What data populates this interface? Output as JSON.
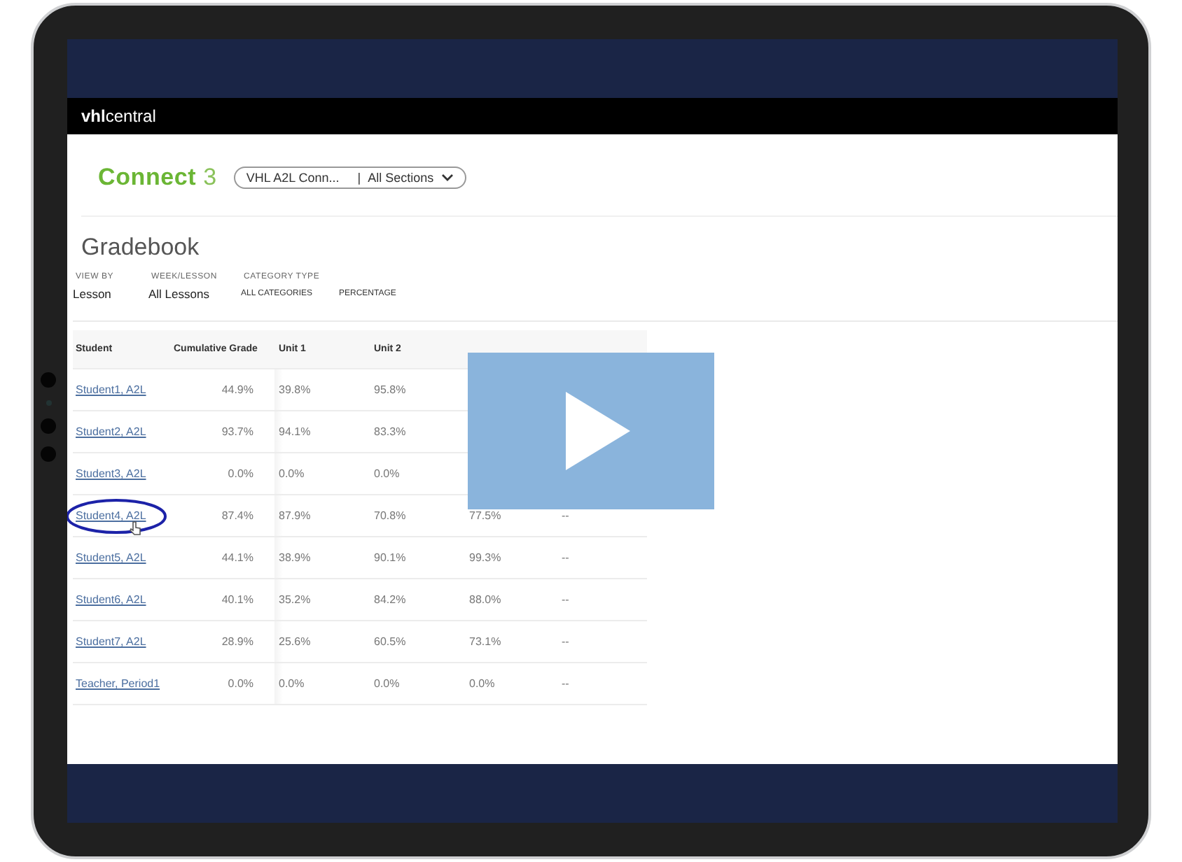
{
  "header": {
    "brand_bold": "vhl",
    "brand_light": "central"
  },
  "product": {
    "name": "Connect",
    "version": "3"
  },
  "course_select": {
    "course": "VHL A2L Conn...",
    "separator": "|",
    "section": "All Sections"
  },
  "page_title": "Gradebook",
  "filters": [
    {
      "label": "VIEW BY",
      "value": "Lesson",
      "kind": "large"
    },
    {
      "label": "WEEK/LESSON",
      "value": "All Lessons",
      "kind": "large"
    },
    {
      "label": "CATEGORY TYPE",
      "value": "ALL CATEGORIES",
      "kind": "small"
    },
    {
      "value": "PERCENTAGE",
      "kind": "small"
    }
  ],
  "table": {
    "columns": [
      "Student",
      "Cumulative Grade",
      "Unit 1",
      "Unit 2"
    ],
    "rows": [
      {
        "circled": false,
        "cells": [
          "Student1, A2L",
          "44.9%",
          "39.8%",
          "95.8%"
        ]
      },
      {
        "circled": false,
        "cells": [
          "Student2, A2L",
          "93.7%",
          "94.1%",
          "83.3%"
        ]
      },
      {
        "circled": false,
        "cells": [
          "Student3, A2L",
          "0.0%",
          "0.0%",
          "0.0%"
        ]
      },
      {
        "circled": true,
        "cells": [
          "Student4, A2L",
          "87.4%",
          "87.9%",
          "70.8%",
          "77.5%",
          "--"
        ]
      },
      {
        "circled": false,
        "cells": [
          "Student5, A2L",
          "44.1%",
          "38.9%",
          "90.1%",
          "99.3%",
          "--"
        ]
      },
      {
        "circled": false,
        "cells": [
          "Student6, A2L",
          "40.1%",
          "35.2%",
          "84.2%",
          "88.0%",
          "--"
        ]
      },
      {
        "circled": false,
        "cells": [
          "Student7, A2L",
          "28.9%",
          "25.6%",
          "60.5%",
          "73.1%",
          "--"
        ]
      },
      {
        "circled": false,
        "cells": [
          "Teacher, Period1",
          "0.0%",
          "0.0%",
          "0.0%",
          "0.0%",
          "--"
        ]
      }
    ]
  },
  "video": {
    "kind": "play-overlay"
  }
}
